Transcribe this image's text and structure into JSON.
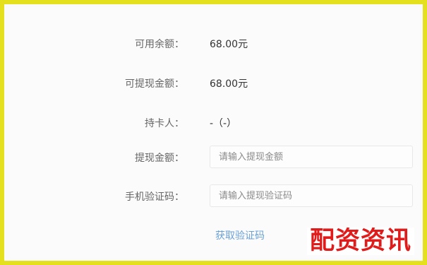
{
  "form": {
    "available": {
      "label": "可用余额：",
      "value": "68.00元"
    },
    "withdrawable": {
      "label": "可提现金额：",
      "value": "68.00元"
    },
    "cardholder": {
      "label": "持卡人：",
      "value": "-（-）"
    },
    "withdraw_amount": {
      "label": "提现金额：",
      "placeholder": "请输入提现金额"
    },
    "verify_code": {
      "label": "手机验证码：",
      "placeholder": "请输入提现验证码"
    },
    "get_code_link": "获取验证码"
  },
  "watermark": "配资资讯",
  "colors": {
    "border": "#e4e01e",
    "link": "#6aa1d8",
    "watermark": "#e11a1a"
  }
}
